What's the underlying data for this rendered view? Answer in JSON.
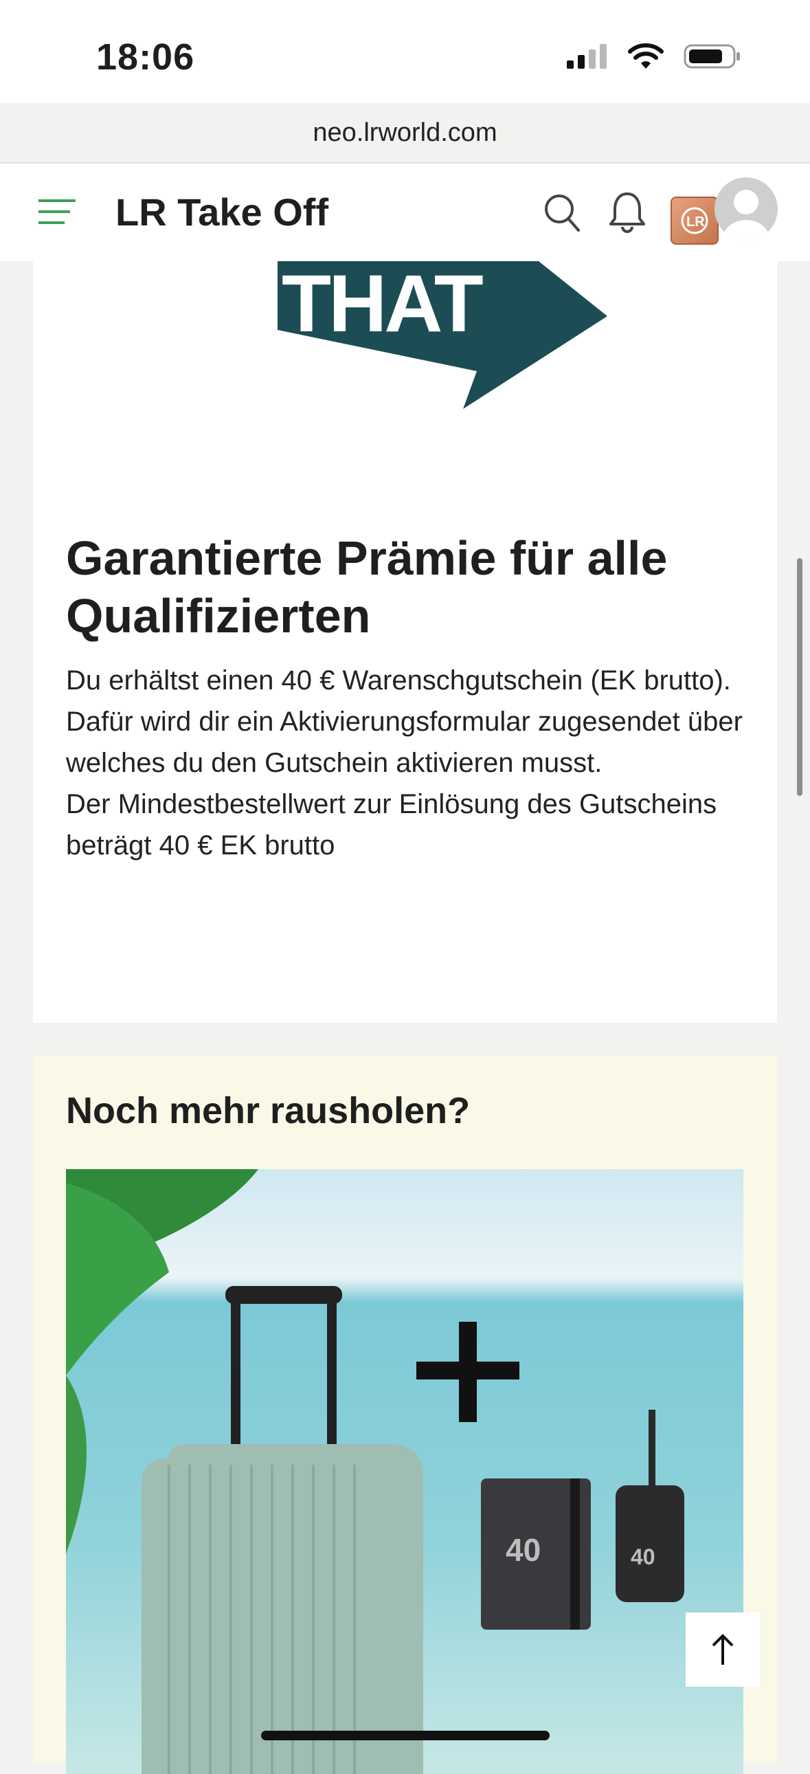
{
  "status_bar": {
    "time": "18:06"
  },
  "browser": {
    "url": "neo.lrworld.com"
  },
  "header": {
    "title": "LR Take Off"
  },
  "logo": {
    "text": "THAT"
  },
  "prize": {
    "title": "Garantierte Prämie für alle Qualifizierten",
    "text": "Du erhältst einen 40 € Warenschgutschein (EK brutto).\nDafür wird dir ein Aktivierungsformular zugesendet über welches du den Gutschein aktivieren musst.\nDer Mindestbestellwert zur Einlösung des Gutscheins beträgt 40 € EK brutto"
  },
  "promo": {
    "title": "Noch mehr rausholen?",
    "image_badge_left": "40",
    "image_badge_right": "40"
  },
  "colors": {
    "accent": "#3ea05a",
    "logo_dark": "#1d4d54",
    "card_cream": "#faf8e6"
  }
}
